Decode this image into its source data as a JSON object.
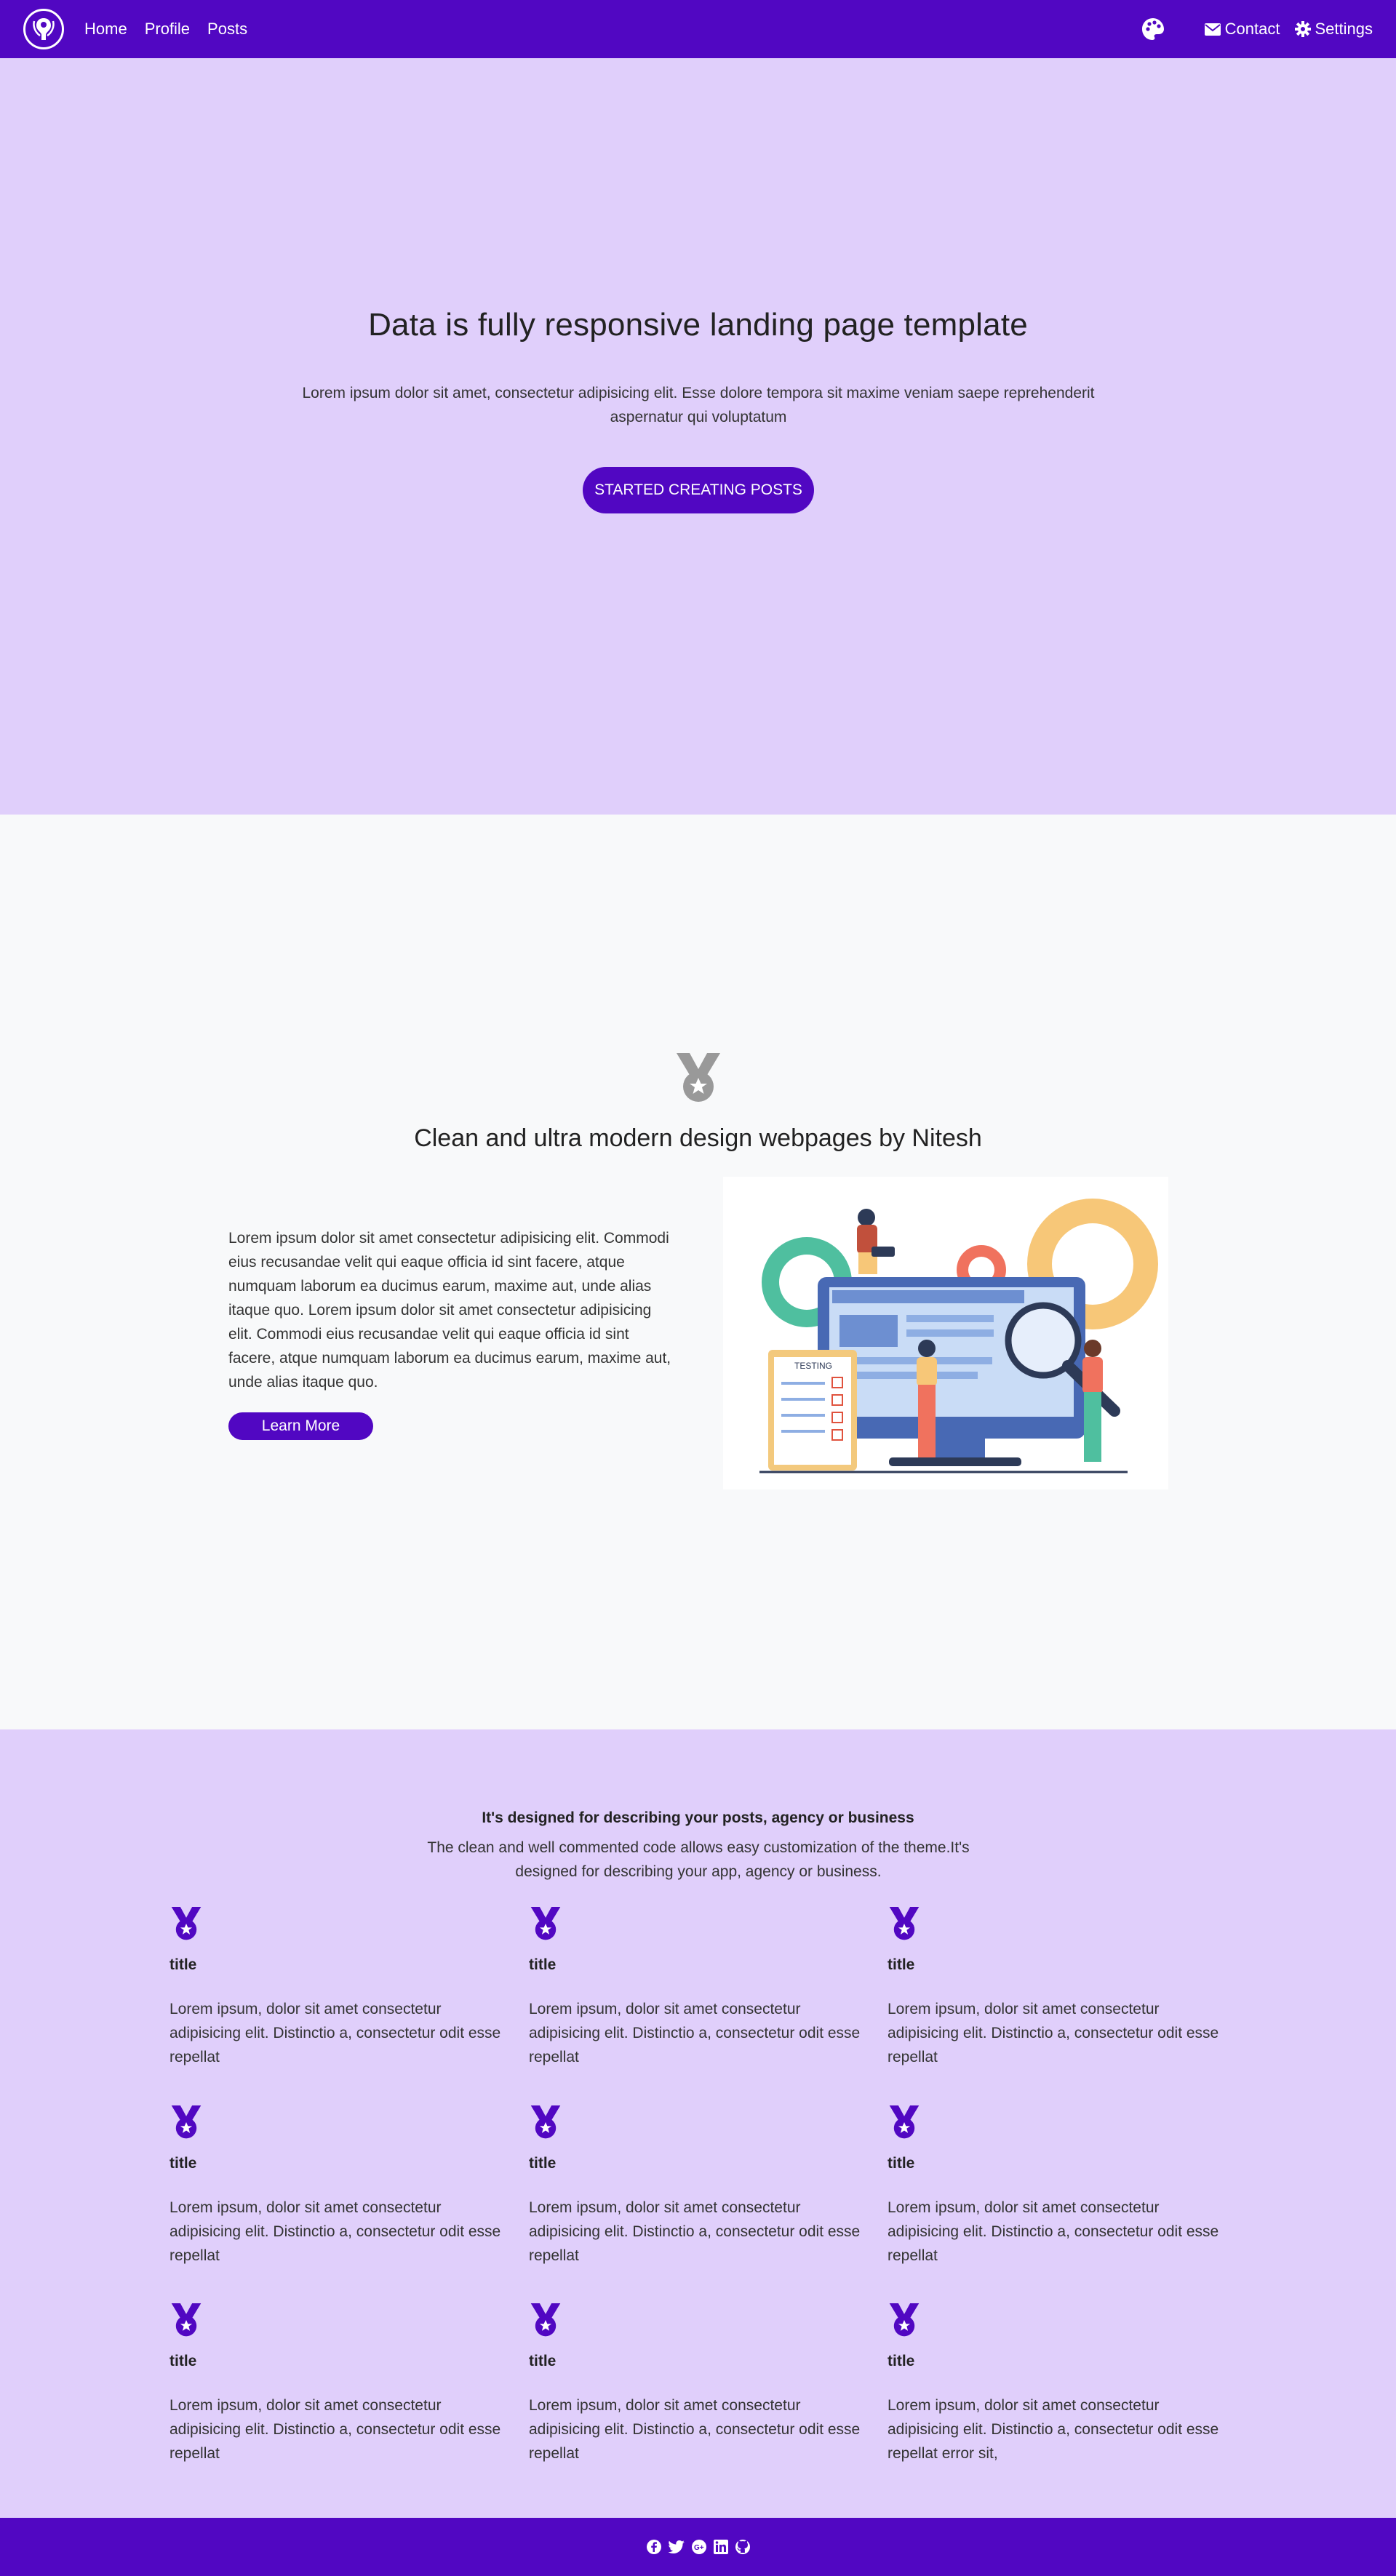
{
  "nav": {
    "links": [
      "Home",
      "Profile",
      "Posts"
    ],
    "contact": "Contact",
    "settings": "Settings"
  },
  "hero": {
    "title": "Data is fully responsive landing page template",
    "text": "Lorem ipsum dolor sit amet, consectetur adipisicing elit. Esse dolore tempora sit maxime veniam saepe reprehenderit aspernatur qui voluptatum",
    "button": "STARTED CREATING POSTS"
  },
  "feature": {
    "title": "Clean and ultra modern design webpages by Nitesh",
    "text": "Lorem ipsum dolor sit amet consectetur adipisicing elit. Commodi eius recusandae velit qui eaque officia id sint facere, atque numquam laborum ea ducimus earum, maxime aut, unde alias itaque quo. Lorem ipsum dolor sit amet consectetur adipisicing elit. Commodi eius recusandae velit qui eaque officia id sint facere, atque numquam laborum ea ducimus earum, maxime aut, unde alias itaque quo.",
    "button": "Learn More",
    "illustration_label": "TESTING"
  },
  "services": {
    "heading": "It's designed for describing your posts, agency or business",
    "subheading": "The clean and well commented code allows easy customization of the theme.It's designed for describing your app, agency or business.",
    "cards": [
      {
        "title": "title",
        "text": "Lorem ipsum, dolor sit amet consectetur adipisicing elit. Distinctio a, consectetur odit esse repellat"
      },
      {
        "title": "title",
        "text": "Lorem ipsum, dolor sit amet consectetur adipisicing elit. Distinctio a, consectetur odit esse repellat"
      },
      {
        "title": "title",
        "text": "Lorem ipsum, dolor sit amet consectetur adipisicing elit. Distinctio a, consectetur odit esse repellat"
      },
      {
        "title": "title",
        "text": "Lorem ipsum, dolor sit amet consectetur adipisicing elit. Distinctio a, consectetur odit esse repellat"
      },
      {
        "title": "title",
        "text": "Lorem ipsum, dolor sit amet consectetur adipisicing elit. Distinctio a, consectetur odit esse repellat"
      },
      {
        "title": "title",
        "text": "Lorem ipsum, dolor sit amet consectetur adipisicing elit. Distinctio a, consectetur odit esse repellat"
      },
      {
        "title": "title",
        "text": "Lorem ipsum, dolor sit amet consectetur adipisicing elit. Distinctio a, consectetur odit esse repellat"
      },
      {
        "title": "title",
        "text": "Lorem ipsum, dolor sit amet consectetur adipisicing elit. Distinctio a, consectetur odit esse repellat"
      },
      {
        "title": "title",
        "text": "Lorem ipsum, dolor sit amet consectetur adipisicing elit. Distinctio a, consectetur odit esse repellat error sit,"
      }
    ]
  },
  "footer": {
    "icons": [
      "facebook-icon",
      "twitter-icon",
      "google-plus-icon",
      "linkedin-icon",
      "github-icon"
    ]
  },
  "colors": {
    "brand": "#5107c2",
    "light_purple": "#e0cffb",
    "light_gray": "#f8f9fa"
  }
}
